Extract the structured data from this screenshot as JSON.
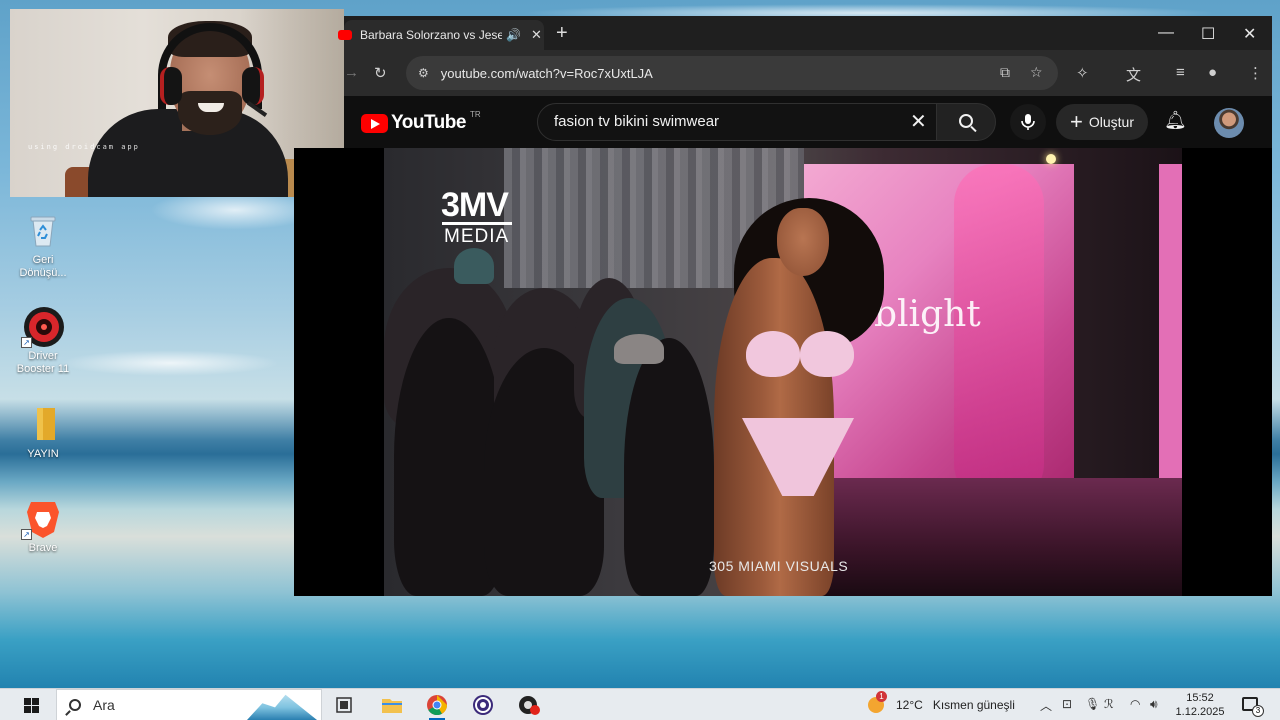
{
  "webcam": {
    "watermark": "using droidcam app"
  },
  "desktop": {
    "icons": [
      {
        "label": "Geri Dönüşü...",
        "icon": "recycle-bin-icon"
      },
      {
        "label": "Driver Booster 11",
        "icon": "driver-booster-icon"
      },
      {
        "label": "YAYIN",
        "icon": "folder-icon"
      },
      {
        "label": "Brave",
        "icon": "brave-icon"
      }
    ]
  },
  "browser": {
    "tab": {
      "title": "Barbara Solorzano vs Jesen",
      "audio": "🔊",
      "close": "✕"
    },
    "new_tab": "+",
    "window_controls": {
      "minimize": "—",
      "maximize": "☐",
      "close": "✕"
    },
    "url": "youtube.com/watch?v=Roc7xUxtLJA"
  },
  "youtube": {
    "logo_text": "YouTube",
    "country_code": "TR",
    "search_value": "fasion tv bikini swimwear",
    "create_label": "Oluştur"
  },
  "video": {
    "logo_top": "3MV",
    "logo_bottom": "MEDIA",
    "caption": "305 MIAMI VISUALS",
    "stage_brand": "blight"
  },
  "taskbar": {
    "search_placeholder": "Ara",
    "weather_temp": "12°C",
    "weather_desc": "Kısmen güneşli",
    "weather_badge": "1",
    "time": "15:52",
    "date": "1.12.2025",
    "notification_count": "3"
  }
}
